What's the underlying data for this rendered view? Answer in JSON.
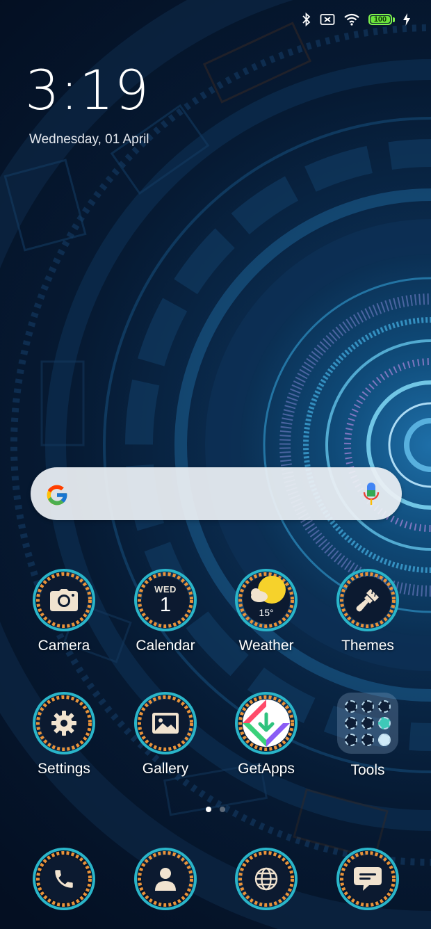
{
  "status_bar": {
    "icons": [
      "bluetooth-icon",
      "no-sim-icon",
      "wifi-icon",
      "battery-icon",
      "charging-bolt-icon"
    ],
    "battery_level": "100"
  },
  "clock": {
    "time": "3:19",
    "date": "Wednesday, 01 April"
  },
  "search": {
    "logo": "google-logo",
    "mic": "mic-icon"
  },
  "apps_row1": [
    {
      "label": "Camera",
      "icon": "camera-icon"
    },
    {
      "label": "Calendar",
      "icon": "calendar-icon",
      "day": "WED",
      "date": "1"
    },
    {
      "label": "Weather",
      "icon": "weather-sun-cloud-icon",
      "temp": "15°"
    },
    {
      "label": "Themes",
      "icon": "paintbrush-icon"
    }
  ],
  "apps_row2": [
    {
      "label": "Settings",
      "icon": "gear-icon"
    },
    {
      "label": "Gallery",
      "icon": "image-icon"
    },
    {
      "label": "GetApps",
      "icon": "getapps-icon"
    },
    {
      "label": "Tools",
      "icon": "folder-icon"
    }
  ],
  "page_indicator": {
    "pages": 2,
    "current": 1
  },
  "dock": [
    {
      "icon": "phone-icon"
    },
    {
      "icon": "contacts-icon"
    },
    {
      "icon": "browser-globe-icon"
    },
    {
      "icon": "messages-icon"
    }
  ],
  "colors": {
    "ring_teal": "#2ab5c9",
    "ring_orange": "#e8923a",
    "icon_cream": "#f1e3cf",
    "icon_bg": "#0c1a30",
    "battery_green": "#6be23a"
  }
}
